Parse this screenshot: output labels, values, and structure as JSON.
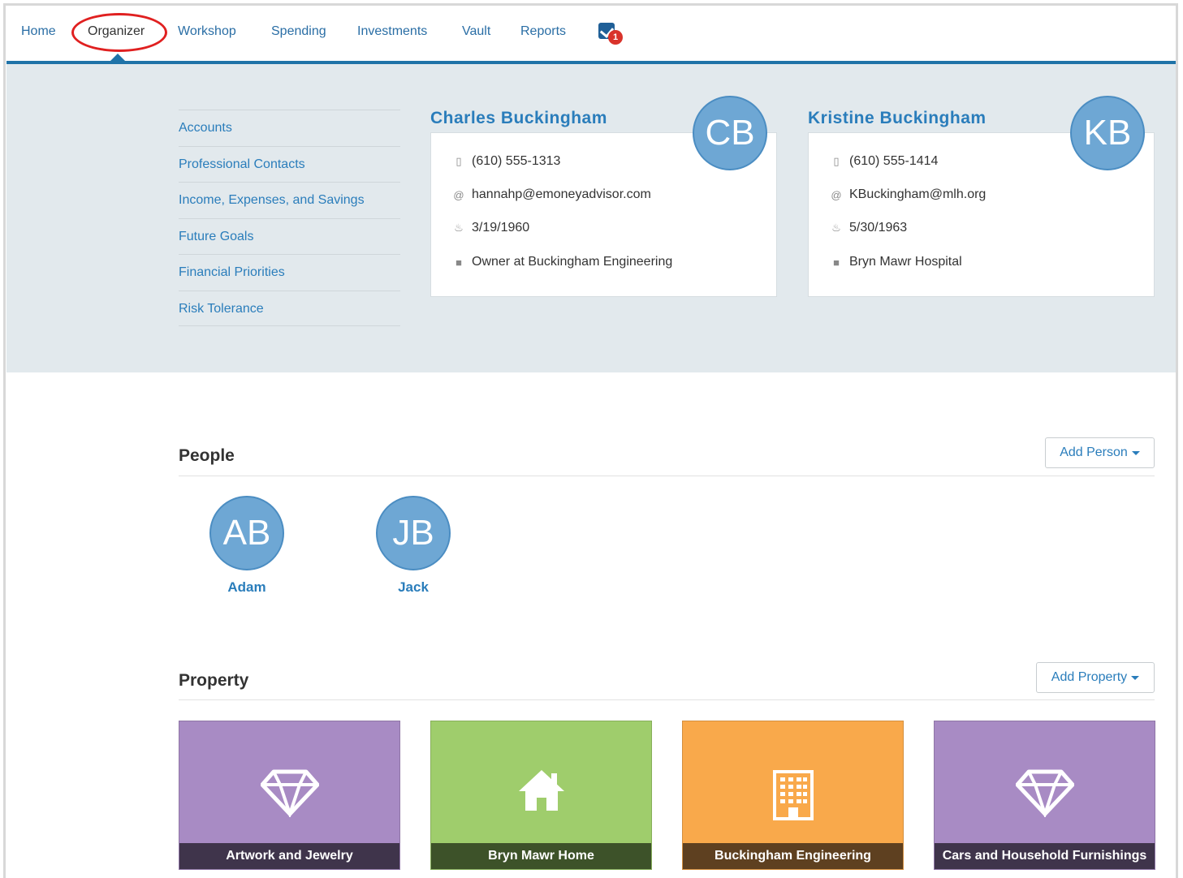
{
  "nav": {
    "items": [
      "Home",
      "Organizer",
      "Workshop",
      "Spending",
      "Investments",
      "Vault",
      "Reports"
    ],
    "active": "Organizer",
    "task_badge": "1"
  },
  "sidebar": {
    "links": [
      "Accounts",
      "Professional Contacts",
      "Income, Expenses, and Savings",
      "Future Goals",
      "Financial Priorities",
      "Risk Tolerance"
    ]
  },
  "clients": [
    {
      "name": "Charles Buckingham",
      "initials": "CB",
      "phone": "(610) 555-1313",
      "email": "hannahp@emoneyadvisor.com",
      "birthdate": "3/19/1960",
      "occupation": "Owner at Buckingham Engineering"
    },
    {
      "name": "Kristine Buckingham",
      "initials": "KB",
      "phone": "(610) 555-1414",
      "email": "KBuckingham@mlh.org",
      "birthdate": "5/30/1963",
      "occupation": "Bryn Mawr Hospital"
    }
  ],
  "people": {
    "title": "People",
    "add_label": "Add Person",
    "members": [
      {
        "initials": "AB",
        "name": "Adam"
      },
      {
        "initials": "JB",
        "name": "Jack"
      }
    ]
  },
  "property": {
    "title": "Property",
    "add_label": "Add Property",
    "tiles": [
      {
        "label": "Artwork and Jewelry",
        "icon": "diamond-icon",
        "color": "#a88bc4",
        "footer_color": "#3f344b"
      },
      {
        "label": "Bryn Mawr Home",
        "icon": "home-icon",
        "color": "#9fcd6c",
        "footer_color": "#3d5229"
      },
      {
        "label": "Buckingham Engineering",
        "icon": "building-icon",
        "color": "#f9a94b",
        "footer_color": "#5e4020"
      },
      {
        "label": "Cars and Household Furnishings",
        "icon": "diamond-icon",
        "color": "#a88bc4",
        "footer_color": "#3f344b"
      }
    ]
  }
}
